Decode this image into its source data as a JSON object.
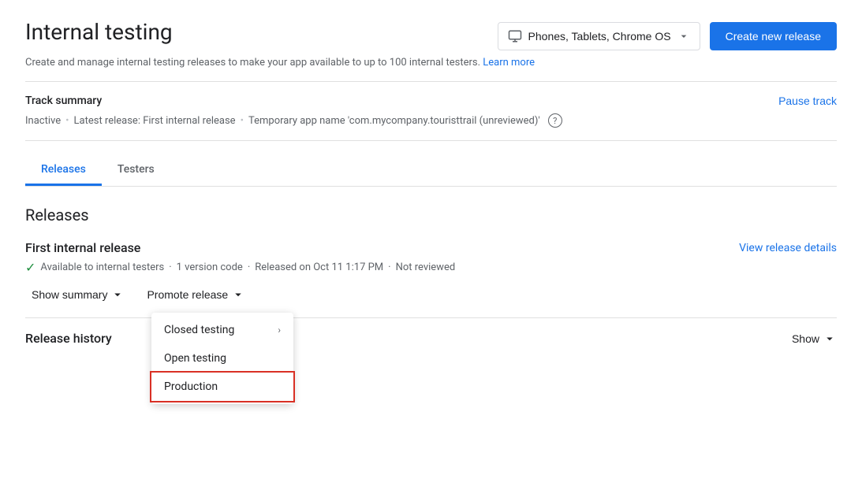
{
  "page": {
    "title": "Internal testing",
    "subtitle": "Create and manage internal testing releases to make your app available to up to 100 internal testers.",
    "learn_more": "Learn more"
  },
  "device_selector": {
    "label": "Phones, Tablets, Chrome OS",
    "icon": "monitor-icon"
  },
  "header": {
    "create_button": "Create new release"
  },
  "track_summary": {
    "label": "Track summary",
    "pause_button": "Pause track",
    "status": "Inactive",
    "latest_release": "Latest release: First internal release",
    "app_name": "Temporary app name 'com.mycompany.touristtrail (unreviewed)'"
  },
  "tabs": [
    {
      "id": "releases",
      "label": "Releases",
      "active": true
    },
    {
      "id": "testers",
      "label": "Testers",
      "active": false
    }
  ],
  "releases_section": {
    "title": "Releases",
    "release": {
      "name": "First internal release",
      "view_details": "View release details",
      "status": "Available to internal testers",
      "version_code": "1 version code",
      "released_on": "Released on Oct 11 1:17 PM",
      "review_status": "Not reviewed"
    },
    "actions": {
      "show_summary": "Show summary",
      "promote_release": "Promote release"
    },
    "dropdown": {
      "items": [
        {
          "id": "closed-testing",
          "label": "Closed testing",
          "has_submenu": true
        },
        {
          "id": "open-testing",
          "label": "Open testing",
          "has_submenu": false
        },
        {
          "id": "production",
          "label": "Production",
          "has_submenu": false,
          "highlighted": true
        }
      ]
    }
  },
  "release_history": {
    "title": "Release history",
    "show_button": "Show"
  }
}
